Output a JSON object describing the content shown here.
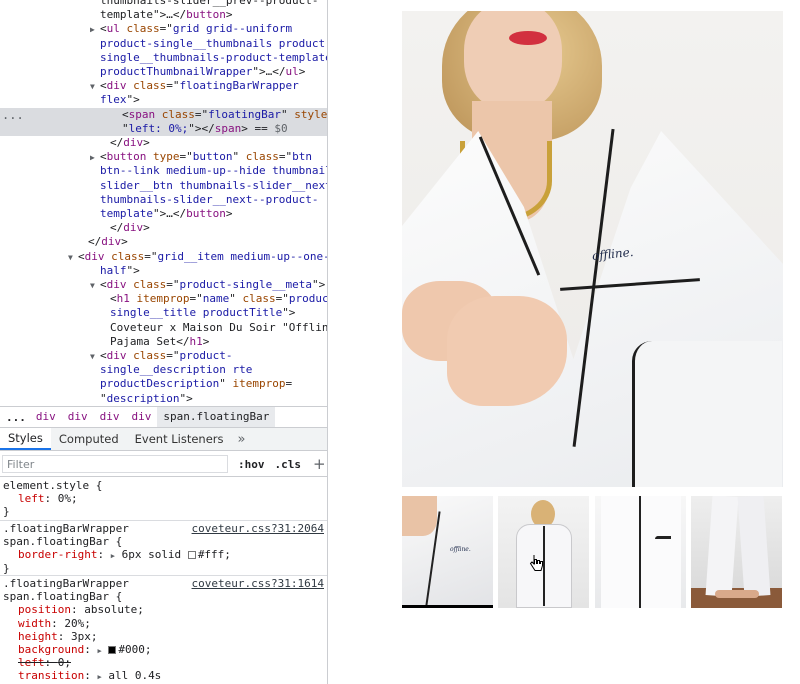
{
  "devtools": {
    "elements_tree": [
      {
        "parts": [
          [
            "tx",
            "thumbnails-slider__prev--product-"
          ]
        ]
      },
      {
        "parts": [
          [
            "tx",
            "template\">…</"
          ],
          [
            "tag",
            "button"
          ],
          [
            "tx",
            ">"
          ]
        ]
      },
      {
        "parts": [
          [
            "tri",
            "▶"
          ],
          [
            "tx",
            "<"
          ],
          [
            "tag",
            "ul"
          ],
          [
            "an",
            " class"
          ],
          [
            "tx",
            "=\""
          ],
          [
            "av",
            "grid grid--uniform"
          ]
        ]
      },
      {
        "parts": [
          [
            "av",
            "product-single__thumbnails product-"
          ]
        ]
      },
      {
        "parts": [
          [
            "av",
            "single__thumbnails-product-template"
          ]
        ]
      },
      {
        "parts": [
          [
            "av",
            "productThumbnailWrapper"
          ],
          [
            "tx",
            "\">…</"
          ],
          [
            "tag",
            "ul"
          ],
          [
            "tx",
            ">"
          ]
        ]
      },
      {
        "parts": [
          [
            "tri",
            "▼"
          ],
          [
            "tx",
            "<"
          ],
          [
            "tag",
            "div"
          ],
          [
            "an",
            " class"
          ],
          [
            "tx",
            "=\""
          ],
          [
            "av",
            "floatingBarWrapper"
          ]
        ]
      },
      {
        "parts": [
          [
            "av",
            "flex"
          ],
          [
            "tx",
            "\">"
          ]
        ]
      },
      {
        "parts": [
          [
            "tx",
            "<"
          ],
          [
            "tag",
            "span"
          ],
          [
            "an",
            " class"
          ],
          [
            "tx",
            "=\""
          ],
          [
            "av",
            "floatingBar"
          ],
          [
            "tx",
            "\" "
          ],
          [
            "an",
            "style"
          ],
          [
            "tx",
            "="
          ]
        ]
      },
      {
        "parts": [
          [
            "tx",
            "\""
          ],
          [
            "av",
            "left: 0%;"
          ],
          [
            "tx",
            "\"></"
          ],
          [
            "tag",
            "span"
          ],
          [
            "tx",
            "> == "
          ],
          [
            "cm",
            "$0"
          ]
        ]
      },
      {
        "parts": [
          [
            "tx",
            "</"
          ],
          [
            "tag",
            "div"
          ],
          [
            "tx",
            ">"
          ]
        ]
      },
      {
        "parts": [
          [
            "tri",
            "▶"
          ],
          [
            "tx",
            "<"
          ],
          [
            "tag",
            "button"
          ],
          [
            "an",
            " type"
          ],
          [
            "tx",
            "=\""
          ],
          [
            "av",
            "button"
          ],
          [
            "tx",
            "\" "
          ],
          [
            "an",
            "class"
          ],
          [
            "tx",
            "=\""
          ],
          [
            "av",
            "btn"
          ]
        ]
      },
      {
        "parts": [
          [
            "av",
            "btn--link medium-up--hide thumbnails-"
          ]
        ]
      },
      {
        "parts": [
          [
            "av",
            "slider__btn thumbnails-slider__next"
          ]
        ]
      },
      {
        "parts": [
          [
            "av",
            "thumbnails-slider__next--product-"
          ]
        ]
      },
      {
        "parts": [
          [
            "av",
            "template"
          ],
          [
            "tx",
            "\">…</"
          ],
          [
            "tag",
            "button"
          ],
          [
            "tx",
            ">"
          ]
        ]
      },
      {
        "parts": [
          [
            "tx",
            "</"
          ],
          [
            "tag",
            "div"
          ],
          [
            "tx",
            ">"
          ]
        ]
      },
      {
        "parts": [
          [
            "tx",
            "</"
          ],
          [
            "tag",
            "div"
          ],
          [
            "tx",
            ">"
          ]
        ]
      },
      {
        "parts": [
          [
            "tri",
            "▼"
          ],
          [
            "tx",
            "<"
          ],
          [
            "tag",
            "div"
          ],
          [
            "an",
            " class"
          ],
          [
            "tx",
            "=\""
          ],
          [
            "av",
            "grid__item medium-up--one-"
          ]
        ]
      },
      {
        "parts": [
          [
            "av",
            "half"
          ],
          [
            "tx",
            "\">"
          ]
        ]
      },
      {
        "parts": [
          [
            "tri",
            "▼"
          ],
          [
            "tx",
            "<"
          ],
          [
            "tag",
            "div"
          ],
          [
            "an",
            " class"
          ],
          [
            "tx",
            "=\""
          ],
          [
            "av",
            "product-single__meta"
          ],
          [
            "tx",
            "\">"
          ]
        ]
      },
      {
        "parts": [
          [
            "tx",
            "<"
          ],
          [
            "tag",
            "h1"
          ],
          [
            "an",
            " itemprop"
          ],
          [
            "tx",
            "=\""
          ],
          [
            "av",
            "name"
          ],
          [
            "tx",
            "\" "
          ],
          [
            "an",
            "class"
          ],
          [
            "tx",
            "=\""
          ],
          [
            "av",
            "product-"
          ]
        ]
      },
      {
        "parts": [
          [
            "av",
            "single__title productTitle"
          ],
          [
            "tx",
            "\">"
          ]
        ]
      },
      {
        "parts": [
          [
            "tx",
            "Coveteur x Maison Du Soir \"Offline\""
          ]
        ]
      },
      {
        "parts": [
          [
            "tx",
            "Pajama Set</"
          ],
          [
            "tag",
            "h1"
          ],
          [
            "tx",
            ">"
          ]
        ]
      },
      {
        "parts": [
          [
            "tri",
            "▼"
          ],
          [
            "tx",
            "<"
          ],
          [
            "tag",
            "div"
          ],
          [
            "an",
            " class"
          ],
          [
            "tx",
            "=\""
          ],
          [
            "av",
            "product-"
          ]
        ]
      },
      {
        "parts": [
          [
            "av",
            "single__description rte"
          ]
        ]
      },
      {
        "parts": [
          [
            "av",
            "productDescription"
          ],
          [
            "tx",
            "\" "
          ],
          [
            "an",
            "itemprop"
          ],
          [
            "tx",
            "="
          ]
        ]
      },
      {
        "parts": [
          [
            "tx",
            "\""
          ],
          [
            "av",
            "description"
          ],
          [
            "tx",
            "\">"
          ]
        ]
      }
    ],
    "selected_dots": "...",
    "breadcrumbs": {
      "ellipsis": "...",
      "items": [
        "div",
        "div",
        "div",
        "div",
        "span.floatingBar"
      ]
    },
    "tabs": [
      "Styles",
      "Computed",
      "Event Listeners"
    ],
    "tabs_more": "»",
    "filter": {
      "placeholder": "Filter",
      "hov": ":hov",
      "cls": ".cls",
      "plus": "+"
    },
    "rules": [
      {
        "selector": [
          "element.style {"
        ],
        "source": "",
        "decls": [
          {
            "prop": "left",
            "value": "0%;"
          }
        ]
      },
      {
        "selector": [
          ".floatingBarWrapper",
          "span.floatingBar {"
        ],
        "source": "coveteur.css?31:2064",
        "decls": [
          {
            "prop": "border-right",
            "arrow": "▶",
            "value": "6px solid ",
            "swatch": "#ffffff",
            "value2": "#fff;"
          }
        ]
      },
      {
        "selector": [
          ".floatingBarWrapper",
          "span.floatingBar {"
        ],
        "source": "coveteur.css?31:1614",
        "decls": [
          {
            "prop": "position",
            "value": "absolute;"
          },
          {
            "prop": "width",
            "value": "20%;"
          },
          {
            "prop": "height",
            "value": "3px;"
          },
          {
            "prop": "background",
            "arrow": "▶",
            "value": "",
            "swatch": "#000000",
            "value2": "#000;"
          },
          {
            "prop": "left",
            "value": "0;",
            "strike": true
          },
          {
            "prop": "transition",
            "arrow": "▶",
            "value": "all 0.4s"
          }
        ]
      }
    ],
    "close_brace": "}"
  },
  "product": {
    "embroidery": "offline.",
    "thumb_embroidery": "offline.",
    "floating_bar": {
      "left_percent": 0,
      "width_percent": 20,
      "color": "#000000"
    },
    "thumbnails": [
      {
        "name": "thumb-closeup-collar"
      },
      {
        "name": "thumb-full-set-front"
      },
      {
        "name": "thumb-shirt-detail"
      },
      {
        "name": "thumb-pants-legs"
      }
    ]
  }
}
